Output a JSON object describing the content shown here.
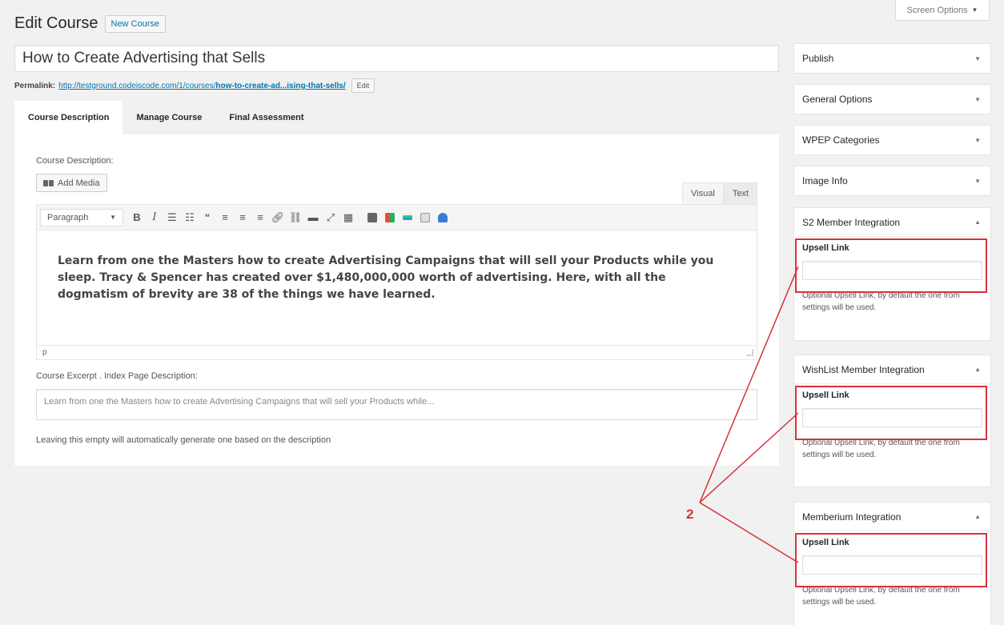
{
  "screen_options": {
    "label": "Screen Options",
    "icon": "triangle-down-icon"
  },
  "page": {
    "title": "Edit Course",
    "new_button": "New Course"
  },
  "post_title": "How to Create Advertising that Sells",
  "permalink": {
    "label": "Permalink:",
    "url_prefix": "http://testground.codeiscode.com/1/courses/",
    "url_slug": "how-to-create-ad...ising-that-sells/",
    "edit_button": "Edit"
  },
  "tabs": [
    "Course Description",
    "Manage Course",
    "Final Assessment"
  ],
  "editor": {
    "section_label": "Course Description:",
    "add_media": "Add Media",
    "visual_tab": "Visual",
    "text_tab": "Text",
    "format_select": "Paragraph",
    "content": "Learn from one the Masters how to create Advertising Campaigns that will sell your Products while you sleep. Tracy & Spencer has created over $1,480,000,000 worth of advertising. Here, with all the dogmatism of brevity are 38 of the things we have learned.",
    "path": "p",
    "toolbar_icons": [
      "bold-icon",
      "italic-icon",
      "bullet-list-icon",
      "numbered-list-icon",
      "blockquote-icon",
      "align-left-icon",
      "align-center-icon",
      "align-right-icon",
      "link-icon",
      "unlink-icon",
      "read-more-icon",
      "fullscreen-icon",
      "toolbar-toggle-icon",
      "shortcode-icon",
      "color-grid-icon",
      "color-bar-icon",
      "list-block-icon",
      "user-lock-icon"
    ]
  },
  "excerpt": {
    "label": "Course Excerpt . Index Page Description:",
    "placeholder": "Learn from one the Masters how to create Advertising Campaigns that will sell your Products while...",
    "hint": "Leaving this empty will automatically generate one based on the description"
  },
  "sidebar": {
    "publish": "Publish",
    "general_options": "General Options",
    "wpep_categories": "WPEP Categories",
    "image_info": "Image Info",
    "s2_member": "S2 Member Integration",
    "wishlist": "WishList Member Integration",
    "memberium": "Memberium Integration",
    "upsell_label": "Upsell Link",
    "upsell_help": "Optional Upsell Link, by default the one from settings will be used."
  },
  "annotation": {
    "number": "2",
    "color": "#d9303b"
  },
  "colors": {
    "accent": "#0073aa",
    "annotation_red": "#d9303b"
  }
}
